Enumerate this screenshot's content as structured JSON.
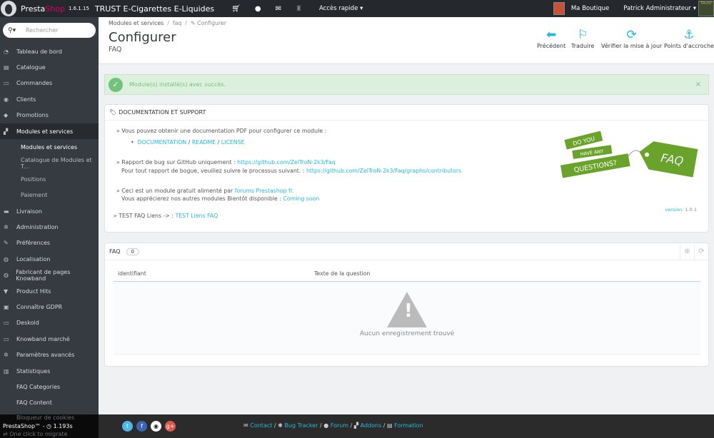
{
  "topbar": {
    "brand_a": "Presta",
    "brand_b": "Shop",
    "version": "1.6.1.15",
    "shop_name": "TRUST E-Cigarettes E-Liquides",
    "quick_access": "Accès rapide",
    "my_shop": "Ma Boutique",
    "user": "Patrick Administrateur",
    "employee_logo_text": "TRUST"
  },
  "search": {
    "placeholder": "Rechercher"
  },
  "sidebar": {
    "items": [
      {
        "label": "Tableau de bord",
        "icon": "dashboard-icon"
      },
      {
        "label": "Catalogue",
        "icon": "book-icon"
      },
      {
        "label": "Commandes",
        "icon": "credit-card-icon"
      },
      {
        "label": "Clients",
        "icon": "users-icon"
      },
      {
        "label": "Promotions",
        "icon": "tag-icon"
      },
      {
        "label": "Modules et services",
        "icon": "puzzle-icon",
        "active": true
      },
      {
        "label": "Livraison",
        "icon": "truck-icon"
      },
      {
        "label": "Administration",
        "icon": "cogs-icon"
      },
      {
        "label": "Préférences",
        "icon": "wrench-icon"
      },
      {
        "label": "Localisation",
        "icon": "globe-icon"
      },
      {
        "label": "Fabricant de pages Knowband",
        "icon": "globe-icon"
      },
      {
        "label": "Product Hits",
        "icon": "thumbtack-icon"
      },
      {
        "label": "Connaître GDPR",
        "icon": "lock-icon"
      },
      {
        "label": "Deskoid",
        "icon": "desktop-icon"
      },
      {
        "label": "Knowband marché",
        "icon": "desktop-icon"
      },
      {
        "label": "Paramètres avancés",
        "icon": "cogs-icon"
      },
      {
        "label": "Statistiques",
        "icon": "bar-chart-icon"
      },
      {
        "label": "FAQ Categories",
        "icon": ""
      },
      {
        "label": "FAQ Content",
        "icon": ""
      },
      {
        "label": "Bloqueur de cookies",
        "icon": ""
      },
      {
        "label": "One click to migrate",
        "icon": "exchange-icon"
      }
    ],
    "submenu": [
      "Modules et services",
      "Catalogue de Modules et T...",
      "Positions",
      "Paiement"
    ]
  },
  "breadcrumb": [
    "Modules et services",
    "faq",
    "Configurer"
  ],
  "page": {
    "title": "Configurer",
    "subtitle": "FAQ"
  },
  "toolbar": [
    {
      "label": "Précédent",
      "icon": "arrow-left-circle-icon"
    },
    {
      "label": "Traduire",
      "icon": "flag-icon"
    },
    {
      "label": "Vérifier la mise à jour",
      "icon": "refresh-icon"
    },
    {
      "label": "Points d'accroche",
      "icon": "anchor-icon"
    }
  ],
  "alert": {
    "text": "Module(s) installé(s) avec succès."
  },
  "doc": {
    "title": "DOCUMENTATION ET SUPPORT",
    "line1": "» Vous pouvez obtenir une documentation PDF pour configurer ce module :",
    "links": [
      "DOCUMENTATION",
      "README",
      "LICENSE"
    ],
    "bug_prefix": "» Rapport de bug sur GitHub uniquement : ",
    "bug_link": "https://github.com/ZelTroN-2k3/Faq",
    "bug2_prefix": "Pour tout rapport de bogue, veuillez suivre le processus suivant. : ",
    "bug2_link": "https://github.com/ZelTroN-2k3/Faq/graphs/contributors",
    "free_prefix": "» Ceci est un module gratuit alimenté par ",
    "free_link": "forums Prestashop fr.",
    "more_prefix": "Vous apprécierez nos autres modules Bientôt disponible : ",
    "more_link": "Coming soon",
    "test_prefix": "» TEST FAQ Liens -> : ",
    "test_link": "TEST Liens FAQ",
    "version_label": "version:",
    "version": "1.0.1",
    "image_text": [
      "DO YOU",
      "HAVE ANY",
      "QUESTIONS?",
      "FAQ"
    ]
  },
  "faq": {
    "title": "FAQ",
    "count": "0",
    "columns": [
      "identifiant",
      "Texte de la question"
    ],
    "empty": "Aucun enregistrement trouvé"
  },
  "footer": {
    "credit": "PrestaShop™ - ",
    "time": "1.193s",
    "links": [
      "Contact",
      "Bug Tracker",
      "Forum",
      "Addons",
      "Formation"
    ]
  },
  "colors": {
    "accent": "#25b9d7",
    "success": "#72c279",
    "sidebar": "#363a41",
    "faq_green": "#6aa329"
  }
}
